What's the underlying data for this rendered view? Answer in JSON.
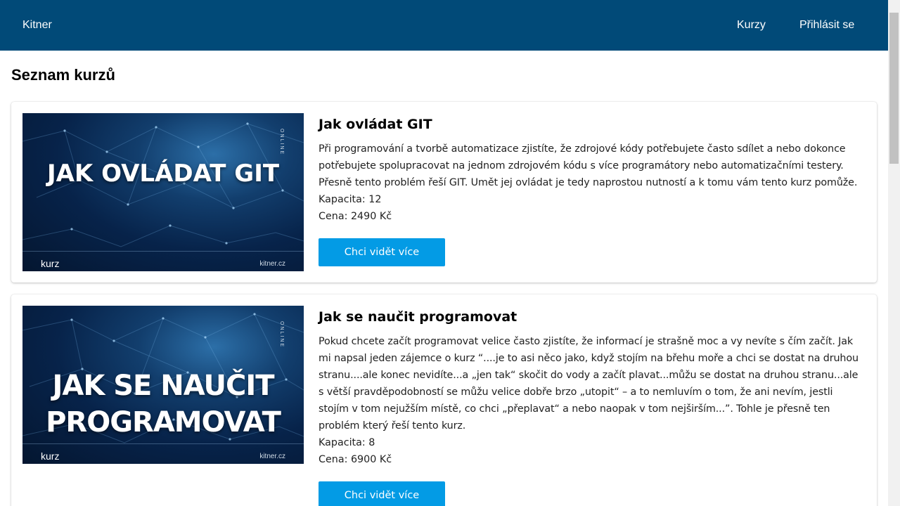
{
  "navbar": {
    "brand": "Kitner",
    "links": [
      "Kurzy",
      "Přihlásit se"
    ],
    "background": "#014a78"
  },
  "page": {
    "title": "Seznam kurzů"
  },
  "courses": [
    {
      "image_title": "JAK OVLÁDAT GIT",
      "image_tag": "kurz",
      "image_domain": "kitner.cz",
      "image_badge": "ONLINE",
      "title": "Jak ovládat GIT",
      "description": "Při programování a tvorbě automatizace zjistíte, že zdrojové kódy potřebujete často sdílet a nebo dokonce potřebujete spolupracovat na jednom zdrojovém kódu s více programátory nebo automatizačními testery. Přesně tento problém řeší GIT. Umět jej ovládat je tedy naprostou nutností a k tomu vám tento kurz pomůže.",
      "capacity": "Kapacita: 12",
      "price": "Cena: 2490 Kč",
      "button": "Chci vidět více"
    },
    {
      "image_title": "JAK SE NAUČIT PROGRAMOVAT",
      "image_tag": "kurz",
      "image_domain": "kitner.cz",
      "image_badge": "ONLINE",
      "title": "Jak se naučit programovat",
      "description": "Pokud chcete začít programovat velice často zjistíte, že informací je strašně moc a vy nevíte s čím začít. Jak mi napsal jeden zájemce o kurz “....je to asi něco jako, když stojím na břehu moře a chci se dostat na druhou stranu....ale konec nevidíte...a „jen tak“ skočit do vody a začít plavat...můžu se dostat na druhou stranu...ale s větší pravděpodobností se můžu velice dobře brzo „utopit“ – a to nemluvím o tom, že ani nevím, jestli stojím v tom nejužším místě, co chci „přeplavat“ a nebo naopak v tom nejširším...”. Tohle je přesně ten problém který řeší tento kurz.",
      "capacity": "Kapacita: 8",
      "price": "Cena: 6900 Kč",
      "button": "Chci vidět více"
    }
  ],
  "colors": {
    "button": "#039be5",
    "thumbnail": "#07234a"
  }
}
